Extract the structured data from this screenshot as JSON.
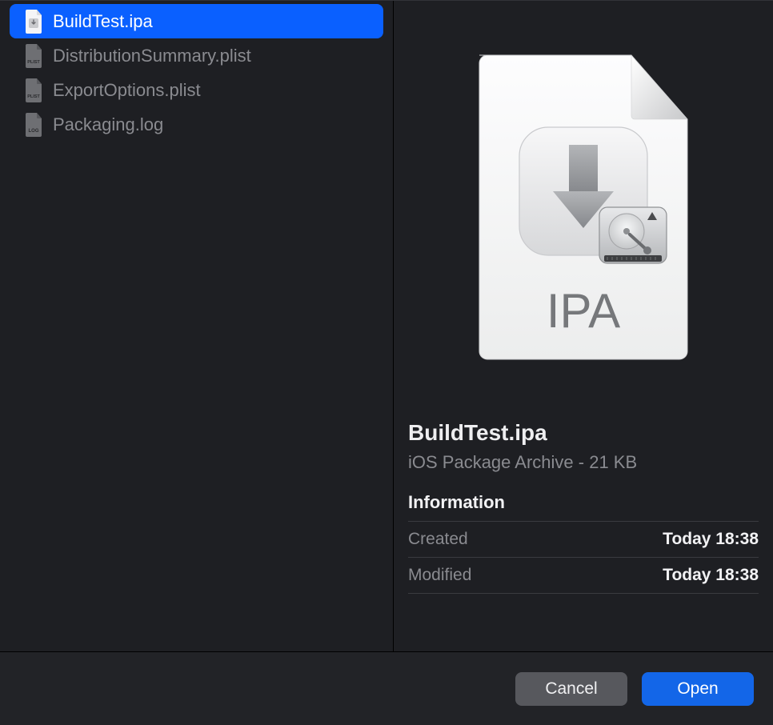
{
  "files": [
    {
      "name": "BuildTest.ipa",
      "iconType": "ipa",
      "selected": true
    },
    {
      "name": "DistributionSummary.plist",
      "iconType": "plist",
      "selected": false
    },
    {
      "name": "ExportOptions.plist",
      "iconType": "plist",
      "selected": false
    },
    {
      "name": "Packaging.log",
      "iconType": "log",
      "selected": false
    }
  ],
  "preview": {
    "filename": "BuildTest.ipa",
    "subtitle": "iOS Package Archive - 21 KB",
    "icon_label": "IPA",
    "info_heading": "Information",
    "rows": [
      {
        "label": "Created",
        "value": "Today 18:38"
      },
      {
        "label": "Modified",
        "value": "Today 18:38"
      }
    ]
  },
  "buttons": {
    "cancel": "Cancel",
    "open": "Open"
  }
}
